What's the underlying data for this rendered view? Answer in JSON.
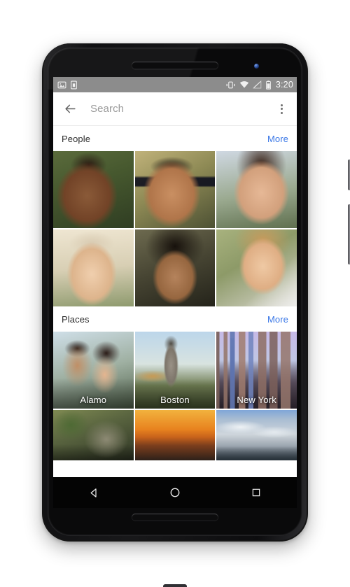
{
  "device": {
    "name": "Nexus 6 phone mockup",
    "earpiece": "speaker-grille",
    "front_camera": "front-camera-dot",
    "power_button": "power-button",
    "volume_button": "volume-rocker"
  },
  "statusbar": {
    "notification_icons": [
      "photo-notification-icon",
      "sim-card-icon"
    ],
    "system_icons": [
      "vibrate-icon",
      "wifi-icon",
      "cell-signal-off-icon",
      "battery-icon"
    ],
    "time": "3:20"
  },
  "toolbar": {
    "back_label": "back-arrow",
    "query": "",
    "placeholder": "Search",
    "overflow_label": "more-options"
  },
  "sections": [
    {
      "id": "people",
      "title": "People",
      "more_label": "More",
      "tiles": [
        {
          "label": "",
          "art": "f1",
          "alt": "smiling man with curly hair outdoors"
        },
        {
          "label": "",
          "art": "f2",
          "alt": "man wearing sunglasses smiling"
        },
        {
          "label": "",
          "art": "f3",
          "alt": "woman with dark hair smiling"
        },
        {
          "label": "",
          "art": "f4",
          "alt": "blond man wearing a beanie"
        },
        {
          "label": "",
          "art": "f5",
          "alt": "laughing woman with dark hair"
        },
        {
          "label": "",
          "art": "f6",
          "alt": "blonde woman in white jacket"
        }
      ]
    },
    {
      "id": "places",
      "title": "Places",
      "more_label": "More",
      "tiles": [
        {
          "label": "Alamo",
          "art": "p1",
          "alt": "couple taking a selfie"
        },
        {
          "label": "Boston",
          "art": "p2",
          "alt": "equestrian statue in a park"
        },
        {
          "label": "New York",
          "art": "p3",
          "alt": "new york city skyline"
        },
        {
          "label": "",
          "art": "p4",
          "alt": "overgrown stone ruins"
        },
        {
          "label": "",
          "art": "p5",
          "alt": "sunset over the ocean"
        },
        {
          "label": "",
          "art": "p6",
          "alt": "clouds above mountains"
        }
      ]
    }
  ],
  "navbar": {
    "back": "back-nav-icon",
    "home": "home-nav-icon",
    "recents": "recents-nav-icon"
  },
  "colors": {
    "accent_link": "#3b78e7",
    "statusbar_bg": "#8c8c8c",
    "screen_bg": "#ffffff",
    "navbar_bg": "#040404",
    "title_text": "#2e2e2e",
    "placeholder_text": "#9a9a9a"
  }
}
